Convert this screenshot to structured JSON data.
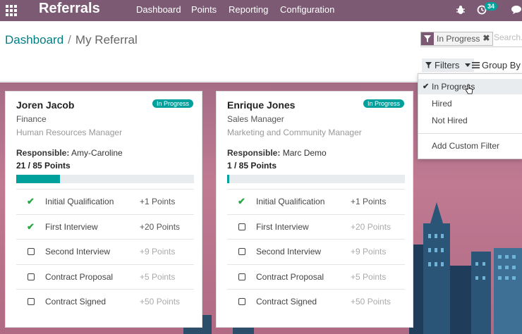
{
  "nav": {
    "brand": "Referrals",
    "menu": [
      "Dashboard",
      "Points",
      "Reporting",
      "Configuration"
    ],
    "activity_count": "34",
    "icons": [
      "apps-icon",
      "bug-icon",
      "clock-icon",
      "chat-icon"
    ]
  },
  "breadcrumb": {
    "parent": "Dashboard",
    "separator": "/",
    "current": "My Referral"
  },
  "search": {
    "facet_value": "In Progress",
    "facet_close": "✖",
    "placeholder": "Search..."
  },
  "toolbar": {
    "filters_label": "Filters",
    "groupby_label": "Group By"
  },
  "filters_menu": {
    "items": [
      {
        "label": "In Progress",
        "checked": true
      },
      {
        "label": "Hired",
        "checked": false
      },
      {
        "label": "Not Hired",
        "checked": false
      }
    ],
    "custom": "Add Custom Filter"
  },
  "cards": [
    {
      "name": "Joren Jacob",
      "status": "In Progress",
      "department": "Finance",
      "job": "Human Resources Manager",
      "responsible_label": "Responsible:",
      "responsible": "Amy-Caroline",
      "points": "21 / 85 Points",
      "progress": 0.247,
      "stages": [
        {
          "name": "Initial Qualification",
          "points": "+1 Points",
          "done": true
        },
        {
          "name": "First Interview",
          "points": "+20 Points",
          "done": true
        },
        {
          "name": "Second Interview",
          "points": "+9 Points",
          "done": false
        },
        {
          "name": "Contract Proposal",
          "points": "+5 Points",
          "done": false
        },
        {
          "name": "Contract Signed",
          "points": "+50 Points",
          "done": false
        }
      ]
    },
    {
      "name": "Enrique Jones",
      "status": "In Progress",
      "department": "Sales Manager",
      "job": "Marketing and Community Manager",
      "responsible_label": "Responsible:",
      "responsible": "Marc Demo",
      "points": "1 / 85 Points",
      "progress": 0.012,
      "stages": [
        {
          "name": "Initial Qualification",
          "points": "+1 Points",
          "done": true
        },
        {
          "name": "First Interview",
          "points": "+20 Points",
          "done": false
        },
        {
          "name": "Second Interview",
          "points": "+9 Points",
          "done": false
        },
        {
          "name": "Contract Proposal",
          "points": "+5 Points",
          "done": false
        },
        {
          "name": "Contract Signed",
          "points": "+50 Points",
          "done": false
        }
      ]
    }
  ],
  "colors": {
    "navbar": "#7c5a74",
    "accent": "#00a09d",
    "check": "#28a745"
  }
}
